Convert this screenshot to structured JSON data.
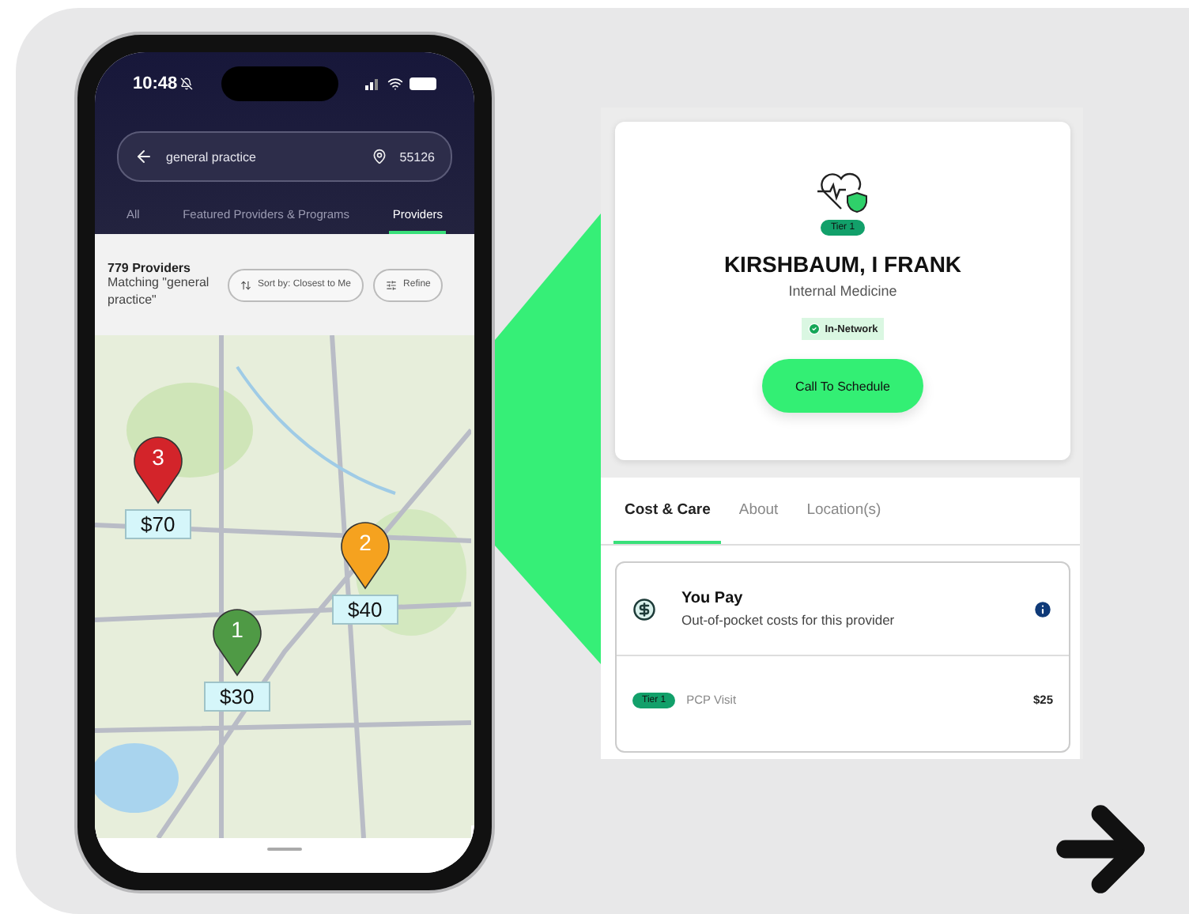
{
  "phone": {
    "status_bar": {
      "time": "10:48"
    },
    "search": {
      "value": "general practice",
      "zip": "55126"
    },
    "tabs": [
      {
        "label": "All",
        "selected": false
      },
      {
        "label": "Featured Providers & Programs",
        "selected": false
      },
      {
        "label": "Providers",
        "selected": true
      }
    ],
    "results": {
      "count": "779 Providers",
      "query": "Matching \"general practice\""
    },
    "sort_button": "Sort by: Closest to Me",
    "refine_button": "Refine",
    "map_pins": [
      {
        "number": "3",
        "price": "$70",
        "color": "#d3242a"
      },
      {
        "number": "2",
        "price": "$40",
        "color": "#f5a21f"
      },
      {
        "number": "1",
        "price": "$30",
        "color": "#4f9a45"
      }
    ]
  },
  "provider": {
    "tier": "Tier 1",
    "name": "KIRSHBAUM, I FRANK",
    "specialty": "Internal Medicine",
    "network": "In-Network",
    "call_button": "Call To Schedule"
  },
  "detail_tabs": [
    {
      "label": "Cost & Care",
      "selected": true
    },
    {
      "label": "About",
      "selected": false
    },
    {
      "label": "Location(s)",
      "selected": false
    }
  ],
  "cost": {
    "title": "You Pay",
    "subtitle": "Out-of-pocket costs for this provider",
    "rows": [
      {
        "tier": "Tier 1",
        "service": "PCP Visit",
        "amount": "$25"
      }
    ]
  }
}
